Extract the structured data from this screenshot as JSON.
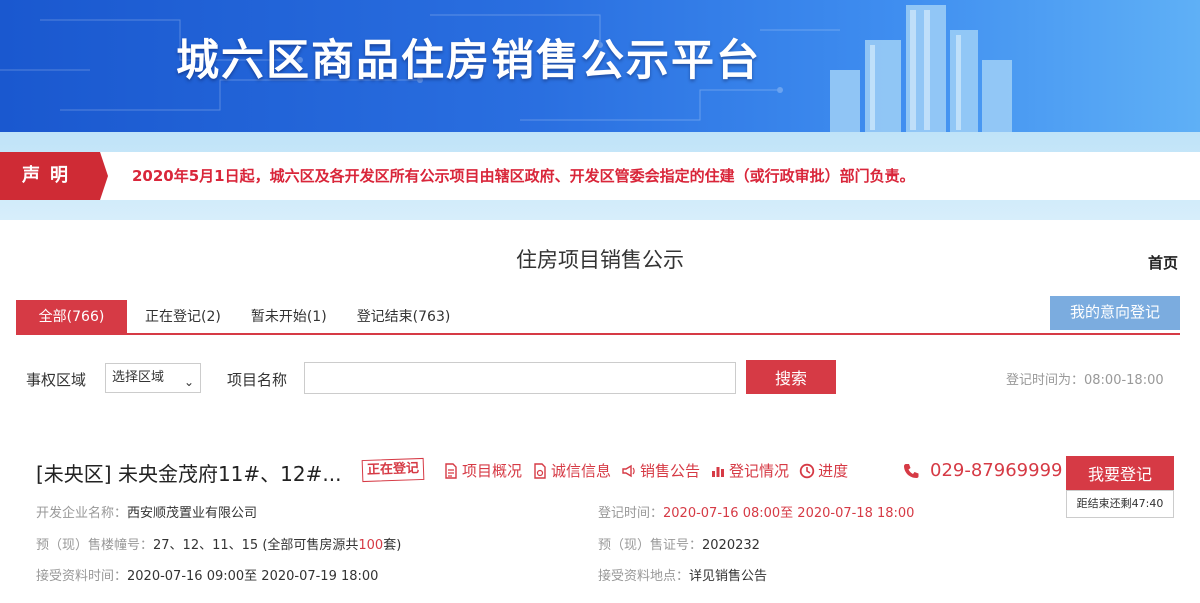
{
  "banner": {
    "title": "城六区商品住房销售公示平台"
  },
  "notice": {
    "tag": "声明",
    "text": "2020年5月1日起，城六区及各开发区所有公示项目由辖区政府、开发区管委会指定的住建（或行政审批）部门负责。"
  },
  "page": {
    "heading": "住房项目销售公示",
    "home": "首页"
  },
  "tabs": [
    {
      "label": "全部(766)",
      "active": true
    },
    {
      "label": "正在登记(2)",
      "active": false
    },
    {
      "label": "暂未开始(1)",
      "active": false
    },
    {
      "label": "登记结束(763)",
      "active": false
    }
  ],
  "my_registration_button": "我的意向登记",
  "search": {
    "district_label": "事权区域",
    "district_value": "选择区域",
    "name_label": "项目名称",
    "name_value": "",
    "button": "搜索",
    "reg_time": "登记时间为：08:00-18:00"
  },
  "project": {
    "title": "[未央区] 未央金茂府11#、12#...",
    "status": "正在登记",
    "links": [
      {
        "label": "项目概况",
        "icon": "document-icon"
      },
      {
        "label": "诚信信息",
        "icon": "file-icon"
      },
      {
        "label": "销售公告",
        "icon": "megaphone-icon"
      },
      {
        "label": "登记情况",
        "icon": "bar-chart-icon"
      },
      {
        "label": "进度",
        "icon": "progress-icon"
      }
    ],
    "phone": "029-87969999",
    "register_button": "我要登记",
    "countdown": "距结束还剩47:40",
    "developer_label": "开发企业名称：",
    "developer": "西安顺茂置业有限公司",
    "reg_period_label": "登记时间：",
    "reg_period": "2020-07-16 08:00至 2020-07-18 18:00",
    "buildings_label": "预（现）售楼幢号：",
    "buildings": "27、12、11、15 (全部可售房源共",
    "buildings_count": "100",
    "buildings_suffix": "套)",
    "permit_label": "预（现）售证号：",
    "permit": "2020232",
    "docs_time_label": "接受资料时间：",
    "docs_time": "2020-07-16 09:00至 2020-07-19 18:00",
    "docs_place_label": "接受资料地点：",
    "docs_place": "详见销售公告"
  },
  "colors": {
    "primary_red": "#d63a45",
    "banner_blue": "#1a58cf",
    "button_blue": "#7bacdf"
  }
}
